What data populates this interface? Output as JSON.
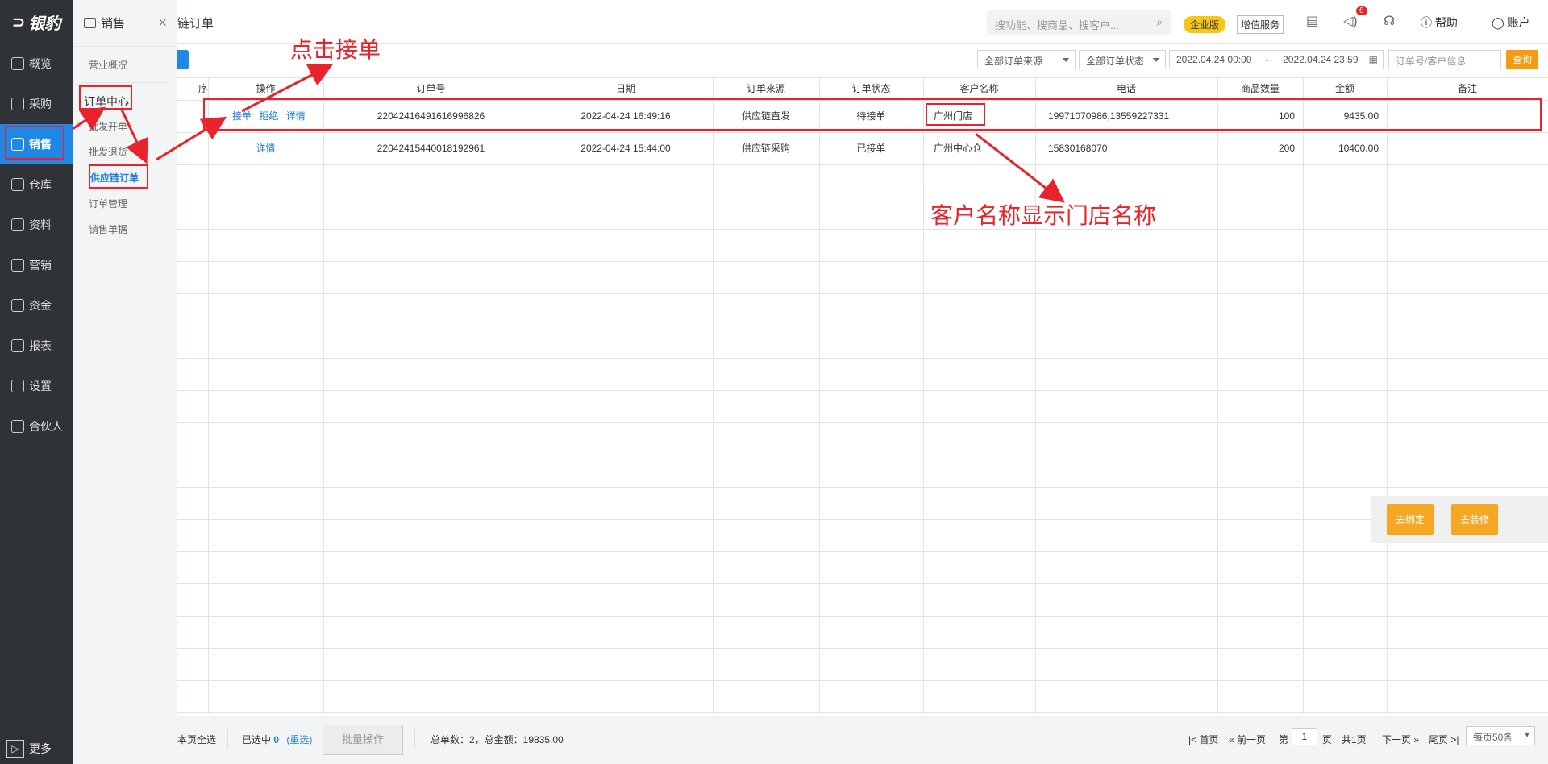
{
  "nav": {
    "logo": "银豹",
    "items": [
      "概览",
      "采购",
      "销售",
      "仓库",
      "资料",
      "营销",
      "资金",
      "报表",
      "设置",
      "合伙人"
    ],
    "active_index": 2,
    "more": "更多"
  },
  "submenu": {
    "title": "销售",
    "close": "×",
    "items": [
      "营业概况",
      "订单中心",
      "批发开单",
      "批发退货",
      "供应链订单",
      "订单管理",
      "销售单据"
    ]
  },
  "topbar": {
    "page_title": "链订单",
    "search_placeholder": "搜功能、搜商品、搜客户...",
    "edition": "企业版",
    "value_added": "增值服务",
    "badge_count": "6",
    "help": "帮助",
    "account": "账户"
  },
  "filters": {
    "source": "全部订单来源",
    "status": "全部订单状态",
    "date_from": "2022.04.24 00:00",
    "date_sep": "-",
    "date_to": "2022.04.24 23:59",
    "keyword_placeholder": "订单号/客户信息",
    "query": "查询"
  },
  "table": {
    "headers": [
      "序",
      "操作",
      "订单号",
      "日期",
      "订单来源",
      "订单状态",
      "客户名称",
      "电话",
      "商品数量",
      "金额",
      "备注"
    ],
    "rows": [
      {
        "actions": [
          "接单",
          "拒绝",
          "详情"
        ],
        "order_no": "22042416491616996826",
        "date": "2022-04-24 16:49:16",
        "source": "供应链直发",
        "status": "待接单",
        "customer": "广州门店",
        "phone": "19971070986,13559227331",
        "qty": "100",
        "amount": "9435.00",
        "remark": ""
      },
      {
        "actions": [
          "详情"
        ],
        "order_no": "22042415440018192961",
        "date": "2022-04-24 15:44:00",
        "source": "供应链采购",
        "status": "已接单",
        "customer": "广州中心仓",
        "phone": "15830168070",
        "qty": "200",
        "amount": "10400.00",
        "remark": ""
      }
    ]
  },
  "footer": {
    "select_page_all": "本页全选",
    "selected_label": "已选中",
    "selected_count": "0",
    "reselect": "(重选)",
    "batch": "批量操作",
    "summary": "总单数：2，总金额：19835.00",
    "first": "首页",
    "prev": "前一页",
    "page_prefix": "第",
    "page_value": "1",
    "page_suffix": "页",
    "total_pages": "共1页",
    "next": "下一页",
    "last": "尾页",
    "per_page": "每页50条"
  },
  "side_buttons": {
    "bind": "去绑定",
    "decorate": "去装修"
  },
  "annotations": {
    "click_accept": "点击接单",
    "customer_note": "客户名称显示门店名称"
  },
  "colors": {
    "accent": "#1f88e5",
    "annotation": "#e8232b",
    "orange": "#f5a623"
  }
}
